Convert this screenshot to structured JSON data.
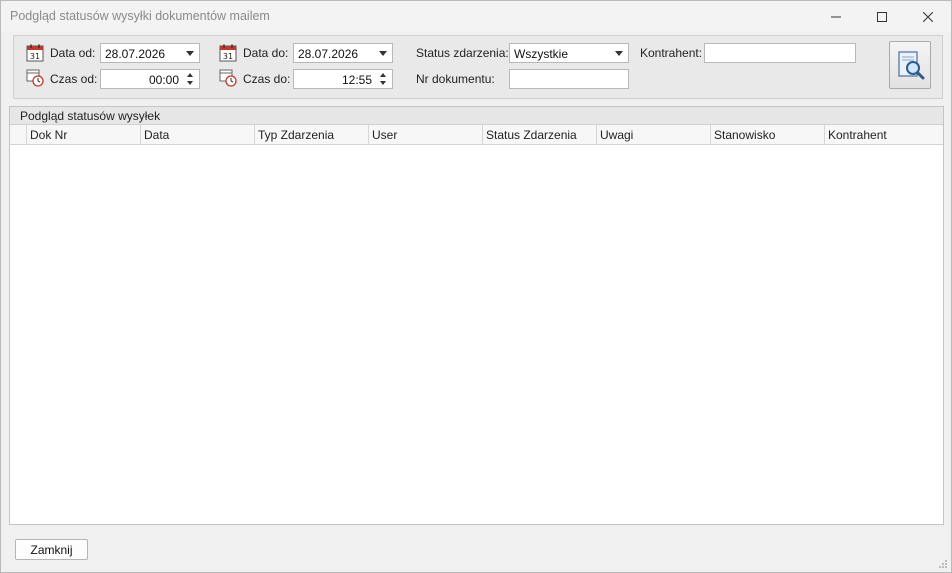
{
  "window": {
    "title": "Podgląd statusów wysyłki dokumentów mailem"
  },
  "filters": {
    "date_from": {
      "label": "Data od:",
      "value": "28.07.2026",
      "icon": "calendar-icon"
    },
    "time_from": {
      "label": "Czas od:",
      "value": "00:00",
      "icon": "clock-icon"
    },
    "date_to": {
      "label": "Data do:",
      "value": "28.07.2026",
      "icon": "calendar-icon"
    },
    "time_to": {
      "label": "Czas do:",
      "value": "12:55",
      "icon": "clock-icon"
    },
    "status": {
      "label": "Status zdarzenia:",
      "value": "Wszystkie"
    },
    "doc_number": {
      "label": "Nr dokumentu:",
      "value": ""
    },
    "contractor": {
      "label": "Kontrahent:",
      "value": ""
    },
    "search_icon": "search-icon"
  },
  "grid": {
    "caption": "Podgląd statusów wysyłek",
    "columns": [
      "Dok Nr",
      "Data",
      "Typ Zdarzenia",
      "User",
      "Status Zdarzenia",
      "Uwagi",
      "Stanowisko",
      "Kontrahent"
    ],
    "rows": []
  },
  "footer": {
    "close_label": "Zamknij"
  }
}
